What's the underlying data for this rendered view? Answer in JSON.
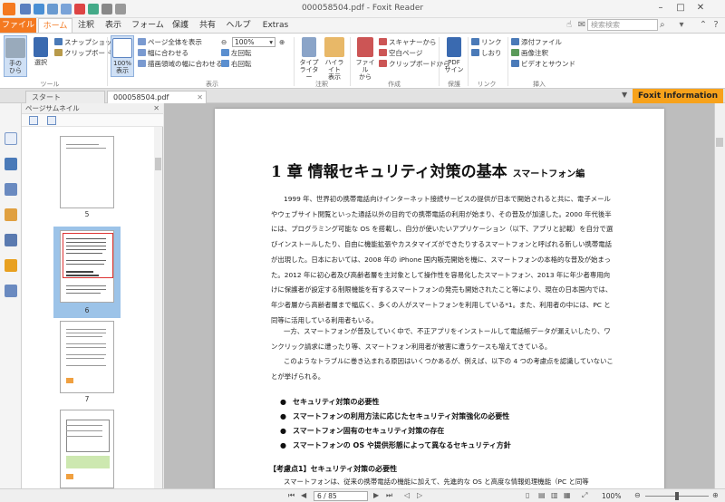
{
  "window": {
    "title": "000058504.pdf - Foxit Reader",
    "search_placeholder": "検索検索"
  },
  "menu": {
    "file": "ファイル",
    "tabs": [
      "ホーム",
      "注釈",
      "表示",
      "フォーム",
      "保護",
      "共有",
      "ヘルプ",
      "Extras"
    ],
    "active": "ホーム"
  },
  "ribbon": {
    "hand": "手の\nひら",
    "select": "選択",
    "snapshot": "スナップショット",
    "clipboard": "クリップボード",
    "tools_group": "ツール",
    "actual_size": "100%\n表示",
    "fit_page": "ページ全体を表示",
    "fit_width": "幅に合わせる",
    "fit_visible": "描画領域の幅に合わせる",
    "zoom_value": "100%",
    "rotate_left": "左回転",
    "rotate_right": "右回転",
    "view_group": "表示",
    "typewriter": "タイプ\nライター",
    "highlight": "ハイライト\n表示",
    "comment_group": "注釈",
    "from_file": "ファイル\nから",
    "from_scanner": "スキャナーから",
    "blank_page": "空白ページ",
    "from_clipboard": "クリップボードから",
    "create_group": "作成",
    "pdf_sign": "PDF\nサイン",
    "protect_group": "保護",
    "link": "リンク",
    "bookmark": "しおり",
    "link_group": "リンク",
    "attach_file": "添付ファイル",
    "image_annot": "画像注釈",
    "video_sound": "ビデオとサウンド",
    "insert_group": "挿入"
  },
  "doctabs": {
    "start": "スタート",
    "current": "000058504.pdf",
    "foxit_info": "Foxit Information"
  },
  "thumbnails": {
    "header": "ページサムネイル",
    "pages": [
      "5",
      "6",
      "7"
    ],
    "selected": "6"
  },
  "document": {
    "title": "1 章 情報セキュリティ対策の基本",
    "subtitle": "スマートフォン編",
    "p1": "1999 年、世界初の携帯電話向けインターネット接続サービスの提供が日本で開始されると共に、電子メールやウェブサイト閲覧といった通話以外の目的での携帯電話の利用が始まり、その普及が加速した。2000 年代後半には、プログラミング可能な OS を搭載し、自分が使いたいアプリケーション（以下、アプリと記載）を自分で選びインストールしたり、自由に機能拡張やカスタマイズができたりするスマートフォンと呼ばれる新しい携帯電話が出現した。日本においては、2008 年の iPhone 国内販売開始を機に、スマートフォンの本格的な普及が始まった。2012 年に初心者及び高齢者層を主対象として操作性を容易化したスマートフォン、2013 年に年少者専用向けに保護者が設定する制限機能を有するスマートフォンの発売も開始されたこと等により、現在の日本国内では、年少者層から高齢者層まで幅広く、多くの人がスマートフォンを利用している*1。また、利用者の中には、PC と同等に活用している利用者もいる。",
    "p2": "一方、スマートフォンが普及していく中で、不正アプリをインストールして電話帳データが漏えいしたり、ワンクリック請求に遭ったり等、スマートフォン利用者が被害に遭うケースも増えてきている。",
    "p3": "このようなトラブルに巻き込まれる原因はいくつかあるが、例えば、以下の 4 つの考慮点を認識していないことが挙げられる。",
    "bullets": [
      "セキュリティ対策の必要性",
      "スマートフォンの利用方法に応じたセキュリティ対策強化の必要性",
      "スマートフォン固有のセキュリティ対策の存在",
      "スマートフォンの OS や提供形態によって異なるセキュリティ方針"
    ],
    "section": "【考慮点1】セキュリティ対策の必要性",
    "p4": "スマートフォンは、従来の携帯電話の機能に加えて、先進的な OS と高度な情報処理機能（PC と同等"
  },
  "status": {
    "page_display": "6 / 85",
    "zoom": "100%"
  },
  "colors": {
    "accent": "#f47920",
    "foxit_info": "#f7a21b",
    "thumb_selection": "#9cc3e8"
  }
}
